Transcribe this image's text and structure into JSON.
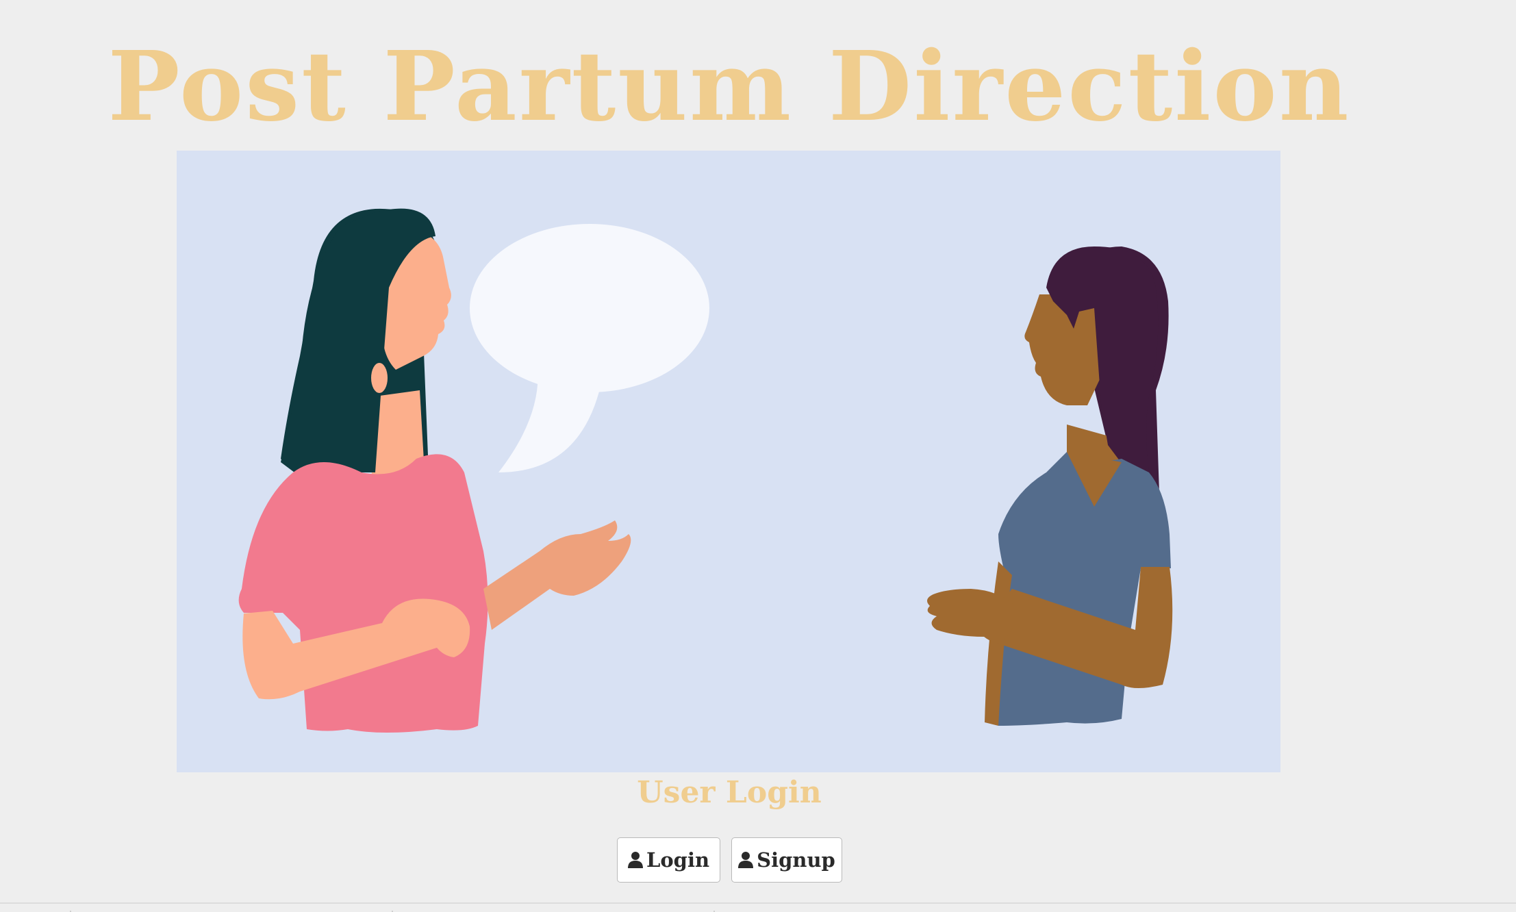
{
  "header": {
    "title": "Post Partum Direction"
  },
  "hero": {
    "alt": "two-women-conversation-illustration",
    "colors": {
      "background": "#d8e1f3",
      "speech_bubble": "#f6f8fd",
      "woman_left_hair": "#0e3a3f",
      "woman_left_skin": "#fcaf8c",
      "woman_left_shirt": "#f27a8e",
      "woman_right_hair": "#3f1c3d",
      "woman_right_skin": "#a06a30",
      "woman_right_shirt": "#546c8c"
    }
  },
  "login_section": {
    "heading": "User Login",
    "login_label": "Login",
    "signup_label": "Signup",
    "button_icon": "user-icon"
  },
  "colors": {
    "page_background": "#eeeeee",
    "accent": "#f0cd8e",
    "button_text": "#2a2a2a"
  }
}
